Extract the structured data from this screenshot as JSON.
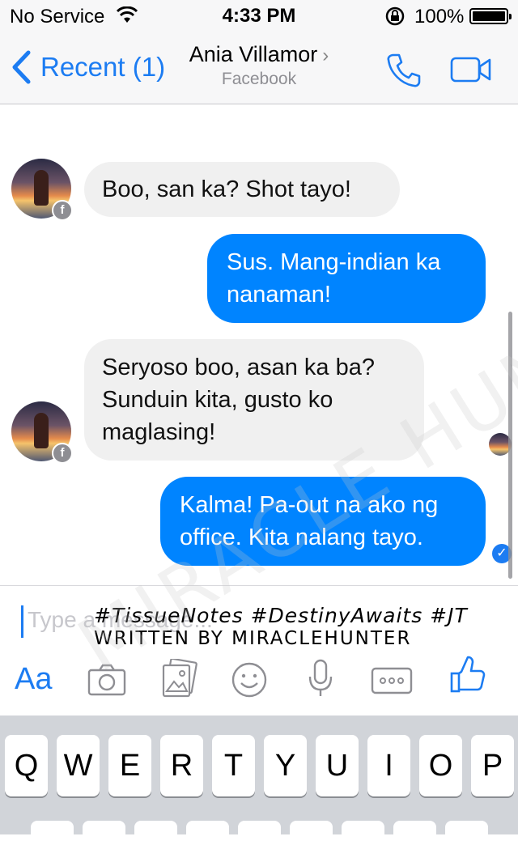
{
  "status_bar": {
    "carrier": "No Service",
    "time": "4:33 PM",
    "battery": "100%"
  },
  "nav": {
    "back_label": "Recent (1)",
    "contact_name": "Ania Villamor",
    "contact_source": "Facebook",
    "icons": [
      "back-chevron-icon",
      "phone-icon",
      "video-camera-icon"
    ]
  },
  "messages": [
    {
      "direction": "incoming",
      "text": "Boo, san ka? Shot tayo!"
    },
    {
      "direction": "outgoing",
      "text": "Sus. Mang-indian ka nanaman!"
    },
    {
      "direction": "incoming",
      "text": "Seryoso boo, asan ka ba? Sunduin kita, gusto ko maglasing!"
    },
    {
      "direction": "outgoing",
      "text": "Kalma! Pa-out na ako ng office. Kita nalang tayo."
    }
  ],
  "composer": {
    "placeholder": "Type a message...",
    "overlay_line1": "#TissueNotes #DestinyAwaits #JT",
    "overlay_line2": "WRITTEN BY MIRACLEHUNTER",
    "aa_label": "Aa",
    "tool_icons": [
      "camera-icon",
      "photos-icon",
      "sticker-icon",
      "microphone-icon",
      "more-icon",
      "thumbs-up-icon"
    ]
  },
  "keyboard": {
    "top_row": [
      "Q",
      "W",
      "E",
      "R",
      "T",
      "Y",
      "U",
      "I",
      "O",
      "P"
    ]
  },
  "watermark": "MIRACLE HUNTER",
  "colors": {
    "accent": "#1c7cf2",
    "outgoing_bubble": "#0084ff",
    "incoming_bubble": "#f0f0f0",
    "keyboard_bg": "#d1d4d9"
  }
}
